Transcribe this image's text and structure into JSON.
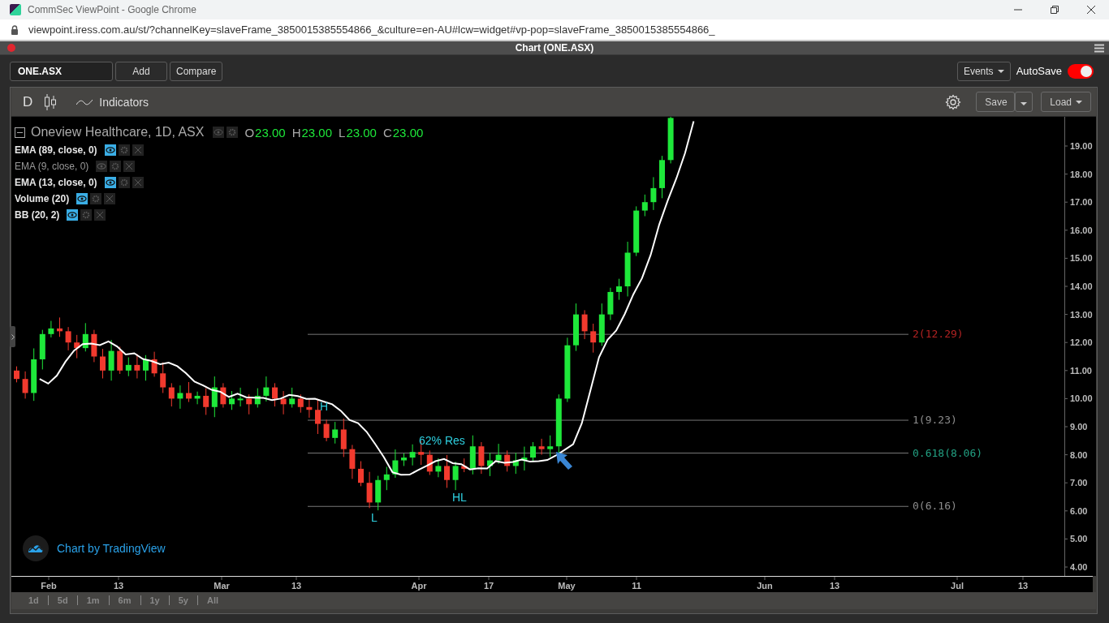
{
  "browser": {
    "title": "CommSec ViewPoint - Google Chrome",
    "url": "viewpoint.iress.com.au/st/?channelKey=slaveFrame_3850015385554866_&culture=en-AU#lcw=widget#vp-pop=slaveFrame_3850015385554866_"
  },
  "window": {
    "title": "Chart (ONE.ASX)"
  },
  "toolbar": {
    "symbol": "ONE.ASX",
    "buttons": [
      "Add",
      "Compare"
    ],
    "events": "Events",
    "autosave": {
      "label": "AutoSave",
      "on": true
    }
  },
  "chart_toolbar": {
    "interval": "D",
    "indicators": "Indicators",
    "save": "Save",
    "load": "Load"
  },
  "legend": {
    "title": "Oneview Healthcare, 1D, ASX",
    "ohlc": [
      {
        "label": "O",
        "value": "23.00"
      },
      {
        "label": "H",
        "value": "23.00"
      },
      {
        "label": "L",
        "value": "23.00"
      },
      {
        "label": "C",
        "value": "23.00"
      }
    ],
    "indicators": [
      {
        "name": "EMA (89, close, 0)",
        "visible": true
      },
      {
        "name": "EMA (9, close, 0)",
        "visible": false
      },
      {
        "name": "EMA (13, close, 0)",
        "visible": true
      },
      {
        "name": "Volume (20)",
        "visible": true
      },
      {
        "name": "BB (20, 2)",
        "visible": true
      }
    ]
  },
  "fib_levels": [
    {
      "label": "2(12.29)",
      "color": "#b22222"
    },
    {
      "label": "1(9.23)",
      "color": "#8c8c8c"
    },
    {
      "label": "0.618(8.06)",
      "color": "#22a082"
    },
    {
      "label": "0(6.16)",
      "color": "#8c8c8c"
    }
  ],
  "annotations": [
    "H",
    "62% Res",
    "HL",
    "L"
  ],
  "price_axis": [
    "19.00",
    "18.00",
    "17.00",
    "16.00",
    "15.00",
    "14.00",
    "13.00",
    "12.00",
    "11.00",
    "10.00",
    "9.00",
    "8.00",
    "7.00",
    "6.00",
    "5.00",
    "4.00"
  ],
  "time_axis": [
    "Feb",
    "13",
    "Mar",
    "13",
    "Apr",
    "17",
    "May",
    "11",
    "Jun",
    "13",
    "Jul",
    "13"
  ],
  "attribution": "Chart by TradingView",
  "ranges": [
    "1d",
    "5d",
    "1m",
    "6m",
    "1y",
    "5y",
    "All"
  ]
}
